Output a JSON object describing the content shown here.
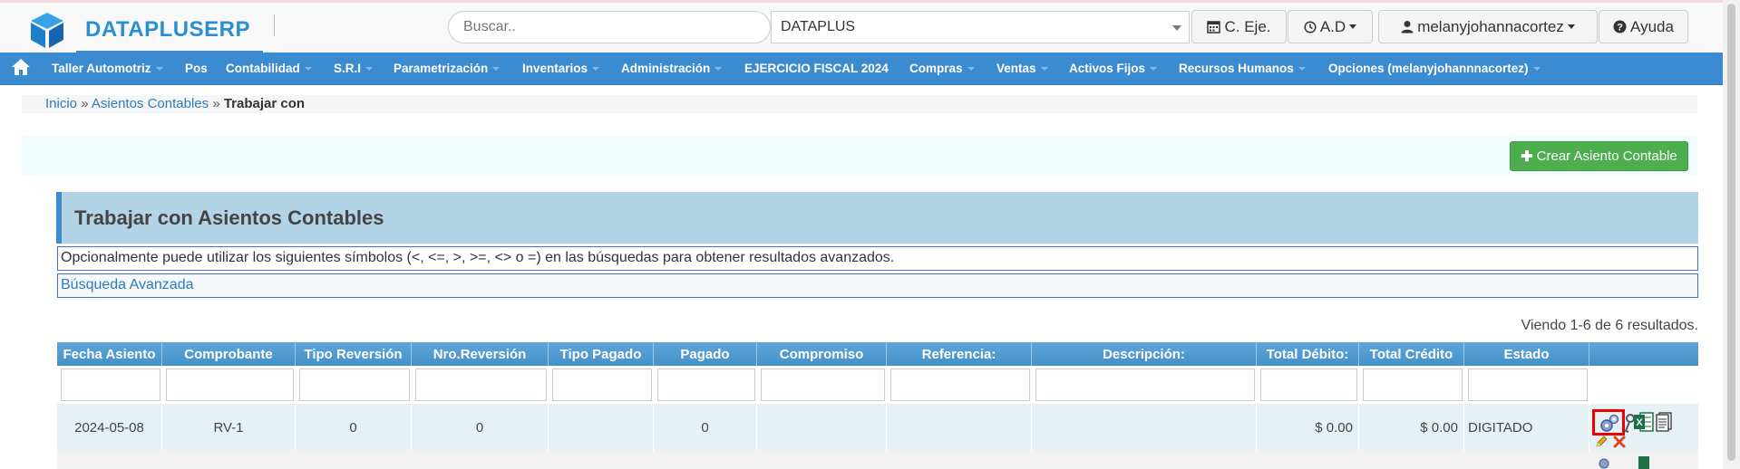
{
  "brand": {
    "name": "DATAPLUSERP"
  },
  "search": {
    "placeholder": "Buscar.."
  },
  "company_select": {
    "value": "DATAPLUS"
  },
  "header_buttons": {
    "ejercicio": "C. Eje.",
    "ad": "A.D",
    "user": "melanyjohannacortez",
    "help": "Ayuda"
  },
  "nav": {
    "items": [
      "Taller Automotriz",
      "Pos",
      "Contabilidad",
      "S.R.I",
      "Parametrización",
      "Inventarios",
      "Administración",
      "EJERCICIO FISCAL 2024",
      "Compras",
      "Ventas",
      "Activos Fijos",
      "Recursos Humanos",
      "Opciones (melanyjohannnacortez)"
    ]
  },
  "breadcrumb": {
    "home": "Inicio",
    "sep": "»",
    "section": "Asientos Contables",
    "current": "Trabajar con"
  },
  "actions": {
    "create": "Crear Asiento Contable"
  },
  "panel": {
    "title": "Trabajar con Asientos Contables",
    "info": "Opcionalmente puede utilizar los siguientes símbolos (<, <=, >, >=, <> o =) en las búsquedas para obtener resultados avanzados.",
    "advanced": "Búsqueda Avanzada"
  },
  "results_summary": "Viendo 1-6 de 6 resultados.",
  "table": {
    "columns": [
      "Fecha Asiento",
      "Comprobante",
      "Tipo Reversión",
      "Nro.Reversión",
      "Tipo Pagado",
      "Pagado",
      "Compromiso",
      "Referencia:",
      "Descripción:",
      "Total Débito:",
      "Total Crédito",
      "Estado",
      ""
    ],
    "rows": [
      [
        "2024-05-08",
        "RV-1",
        "0",
        "0",
        "",
        "0",
        "",
        "",
        "",
        "$ 0.00",
        "$ 0.00",
        "DIGITADO",
        ""
      ]
    ]
  },
  "colors": {
    "nav": "#3b8bd0",
    "brand": "#2b8fd6",
    "create_button": "#4cae4c",
    "highlight": "#ee0000"
  }
}
